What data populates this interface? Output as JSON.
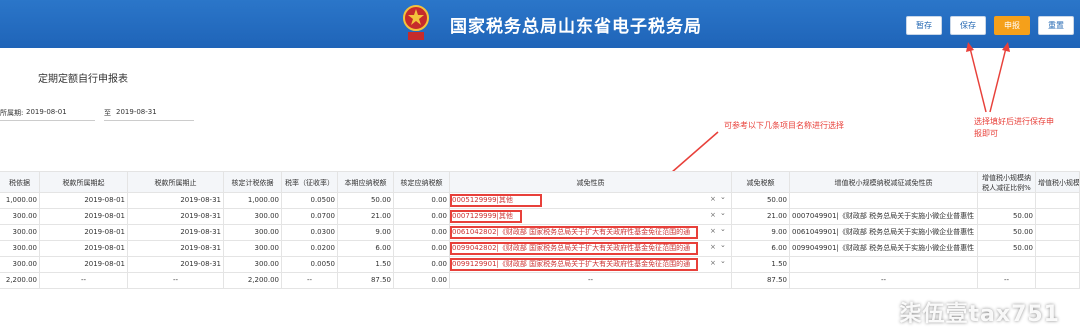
{
  "header": {
    "site_title": "国家税务总局山东省电子税务局",
    "buttons": [
      "暂存",
      "保存",
      "申报",
      "重置"
    ]
  },
  "form": {
    "title": "定期定额自行申报表",
    "period_label": "所属期:",
    "period_start": "2019-08-01",
    "period_sep": "至",
    "period_end": "2019-08-31"
  },
  "annotations": {
    "note_select": "可参考以下几条项目名称进行选择",
    "note_save_line1": "选择填好后进行保存申",
    "note_save_line2": "报即可"
  },
  "table": {
    "headers": [
      "税依据",
      "税款所属期起",
      "税款所属期止",
      "核定计税依据",
      "税率（征收率）",
      "本期应纳税额",
      "核定应纳税额",
      "减免性质",
      "减免税额",
      "增值税小规模纳税减征减免性质",
      "增值税小规模纳税人减征比例%",
      "增值税小规模纳"
    ],
    "rows": [
      {
        "c0": "1,000.00",
        "c1": "2019-08-01",
        "c2": "2019-08-31",
        "c3": "1,000.00",
        "c4": "0.0500",
        "c5": "50.00",
        "c6": "0.00",
        "c7": "0005129999|其他",
        "c8": "50.00",
        "c9": "",
        "c10": ""
      },
      {
        "c0": "300.00",
        "c1": "2019-08-01",
        "c2": "2019-08-31",
        "c3": "300.00",
        "c4": "0.0700",
        "c5": "21.00",
        "c6": "0.00",
        "c7": "0007129999|其他",
        "c8": "21.00",
        "c9": "0007049901|《财政部 税务总局关于实施小微企业普惠性",
        "c10": "50.00"
      },
      {
        "c0": "300.00",
        "c1": "2019-08-01",
        "c2": "2019-08-31",
        "c3": "300.00",
        "c4": "0.0300",
        "c5": "9.00",
        "c6": "0.00",
        "c7": "0061042802|《财政部 国家税务总局关于扩大有关政府性基金免征范围的通",
        "c8": "9.00",
        "c9": "0061049901|《财政部 税务总局关于实施小微企业普惠性",
        "c10": "50.00"
      },
      {
        "c0": "300.00",
        "c1": "2019-08-01",
        "c2": "2019-08-31",
        "c3": "300.00",
        "c4": "0.0200",
        "c5": "6.00",
        "c6": "0.00",
        "c7": "0099042802|《财政部 国家税务总局关于扩大有关政府性基金免征范围的通",
        "c8": "6.00",
        "c9": "0099049901|《财政部 税务总局关于实施小微企业普惠性",
        "c10": "50.00"
      },
      {
        "c0": "300.00",
        "c1": "2019-08-01",
        "c2": "2019-08-31",
        "c3": "300.00",
        "c4": "0.0050",
        "c5": "1.50",
        "c6": "0.00",
        "c7": "0099129901|《财政部 国家税务总局关于扩大有关政府性基金免征范围的通",
        "c8": "1.50",
        "c9": "",
        "c10": ""
      }
    ],
    "total": {
      "c0": "2,200.00",
      "c1": "--",
      "c2": "--",
      "c3": "2,200.00",
      "c4": "--",
      "c5": "87.50",
      "c6": "0.00",
      "c7": "--",
      "c8": "87.50",
      "c9": "--",
      "c10": "--"
    },
    "clear_glyph": "×",
    "dropdown_glyph": "⌄"
  },
  "watermark": "柒伍壹tax751",
  "colors": {
    "header_blue": "#2270c0",
    "accent_orange": "#f5a01a",
    "annotation_red": "#e8403a"
  }
}
